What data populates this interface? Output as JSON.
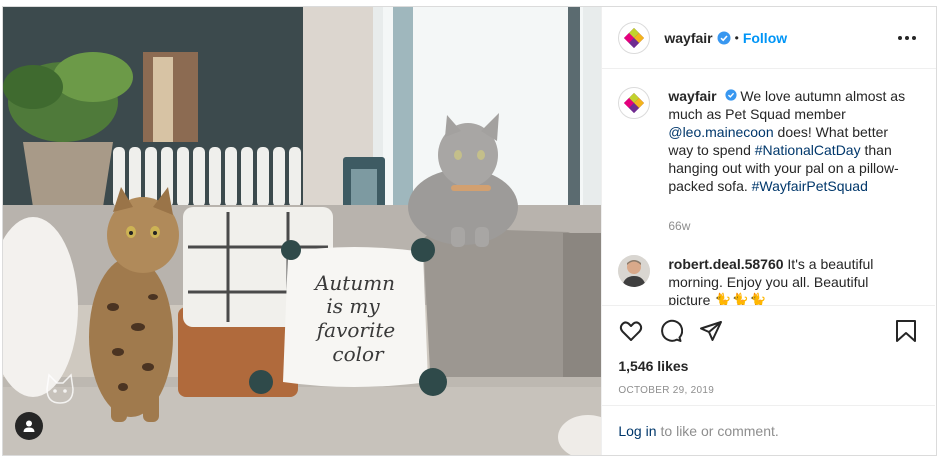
{
  "header": {
    "username": "wayfair",
    "separator": "•",
    "follow_label": "Follow"
  },
  "caption": {
    "username": "wayfair",
    "text_1": "We love autumn almost as much as Pet Squad member ",
    "mention": "@leo.mainecoon",
    "text_2": " does! What better way to spend ",
    "hashtag_1": "#NationalCatDay",
    "text_3": " than hanging out with your pal on a pillow-packed sofa. ",
    "hashtag_2": "#WayfairPetSquad",
    "time": "66w"
  },
  "comment": {
    "username": "robert.deal.58760",
    "text": "It's a beautiful morning. Enjoy you all. Beautiful picture 🐈🐈🐈"
  },
  "actions": {
    "likes": "1,546 likes",
    "date": "October 29, 2019"
  },
  "login": {
    "link_label": "Log in",
    "suffix": "to like or comment."
  },
  "photo": {
    "pillow_text_line1": "Autumn",
    "pillow_text_line2": "is my",
    "pillow_text_line3": "favorite",
    "pillow_text_line4": "color"
  },
  "colors": {
    "follow": "#0095f6",
    "link": "#00376b",
    "verified": "#3897f0",
    "muted": "#8e8e8e"
  },
  "icons": [
    "verified-badge-icon",
    "more-options-icon",
    "heart-icon",
    "comment-icon",
    "share-icon",
    "bookmark-icon",
    "user-tag-icon"
  ]
}
